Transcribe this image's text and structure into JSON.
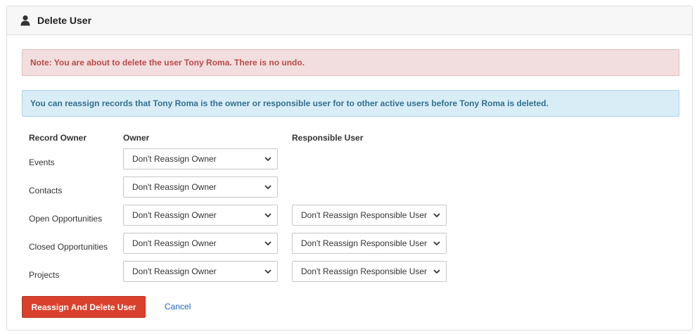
{
  "panel": {
    "title": "Delete User",
    "icon": "user-icon"
  },
  "alerts": {
    "danger": "Note: You are about to delete the user Tony Roma. There is no undo.",
    "info": "You can reassign records that Tony Roma is the owner or responsible user for to other active users before Tony Roma is deleted."
  },
  "table": {
    "headers": {
      "record_owner": "Record Owner",
      "owner": "Owner",
      "responsible_user": "Responsible User"
    },
    "rows": [
      {
        "label": "Events",
        "owner": "Don't Reassign Owner",
        "responsible": null
      },
      {
        "label": "Contacts",
        "owner": "Don't Reassign Owner",
        "responsible": null
      },
      {
        "label": "Open Opportunities",
        "owner": "Don't Reassign Owner",
        "responsible": "Don't Reassign Responsible User"
      },
      {
        "label": "Closed Opportunities",
        "owner": "Don't Reassign Owner",
        "responsible": "Don't Reassign Responsible User"
      },
      {
        "label": "Projects",
        "owner": "Don't Reassign Owner",
        "responsible": "Don't Reassign Responsible User"
      }
    ]
  },
  "actions": {
    "delete_label": "Reassign And Delete User",
    "cancel_label": "Cancel"
  },
  "colors": {
    "danger_bg": "#f2dede",
    "danger_text": "#b94a48",
    "info_bg": "#d9edf7",
    "info_text": "#31708f",
    "primary_button": "#d9412c",
    "link": "#1f63b6"
  }
}
